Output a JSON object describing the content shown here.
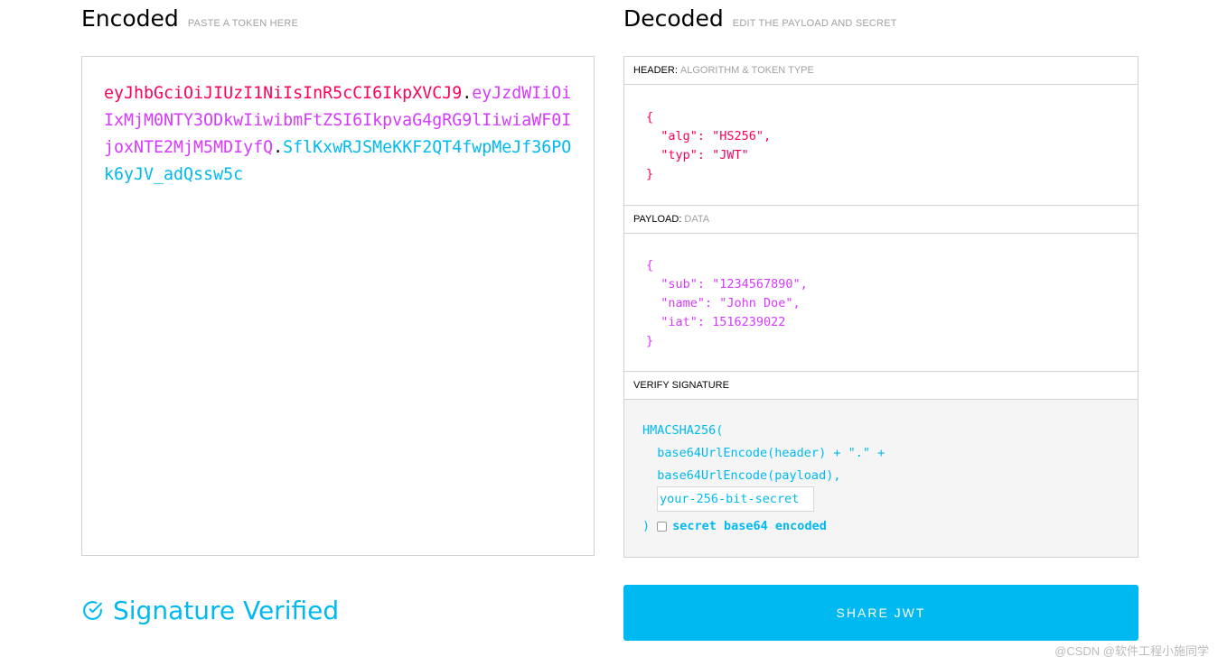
{
  "encoded": {
    "title": "Encoded",
    "subtitle": "PASTE A TOKEN HERE",
    "token_header": "eyJhbGciOiJIUzI1NiIsInR5cCI6IkpXVCJ9",
    "token_payload": "eyJzdWIiOiIxMjM0NTY3ODkwIiwibmFtZSI6IkpvaG4gRG9lIiwiaWF0IjoxNTE2MjM5MDIyfQ",
    "token_signature": "SflKxwRJSMeKKF2QT4fwpMeJf36POk6yJV_adQssw5c",
    "dot": "."
  },
  "decoded": {
    "title": "Decoded",
    "subtitle": "EDIT THE PAYLOAD AND SECRET",
    "header_section": {
      "label": "HEADER:",
      "hint": "ALGORITHM & TOKEN TYPE"
    },
    "header_json": "{\n  \"alg\": \"HS256\",\n  \"typ\": \"JWT\"\n}",
    "payload_section": {
      "label": "PAYLOAD:",
      "hint": "DATA"
    },
    "payload_json": "{\n  \"sub\": \"1234567890\",\n  \"name\": \"John Doe\",\n  \"iat\": 1516239022\n}",
    "verify_section": {
      "label": "VERIFY SIGNATURE"
    },
    "verify_code": "HMACSHA256(\n  base64UrlEncode(header) + \".\" +\n  base64UrlEncode(payload),",
    "secret_placeholder": "your-256-bit-secret",
    "close_paren": ")",
    "checkbox_label": "secret base64 encoded",
    "checkbox_checked": false
  },
  "status": {
    "text": "Signature Verified",
    "icon": "check-circle-icon"
  },
  "share_button": "SHARE JWT",
  "watermark": "@CSDN @软件工程小施同学",
  "colors": {
    "header": "#fb015b",
    "payload": "#d63aff",
    "signature": "#00b9f1",
    "accent": "#00b9f1"
  }
}
